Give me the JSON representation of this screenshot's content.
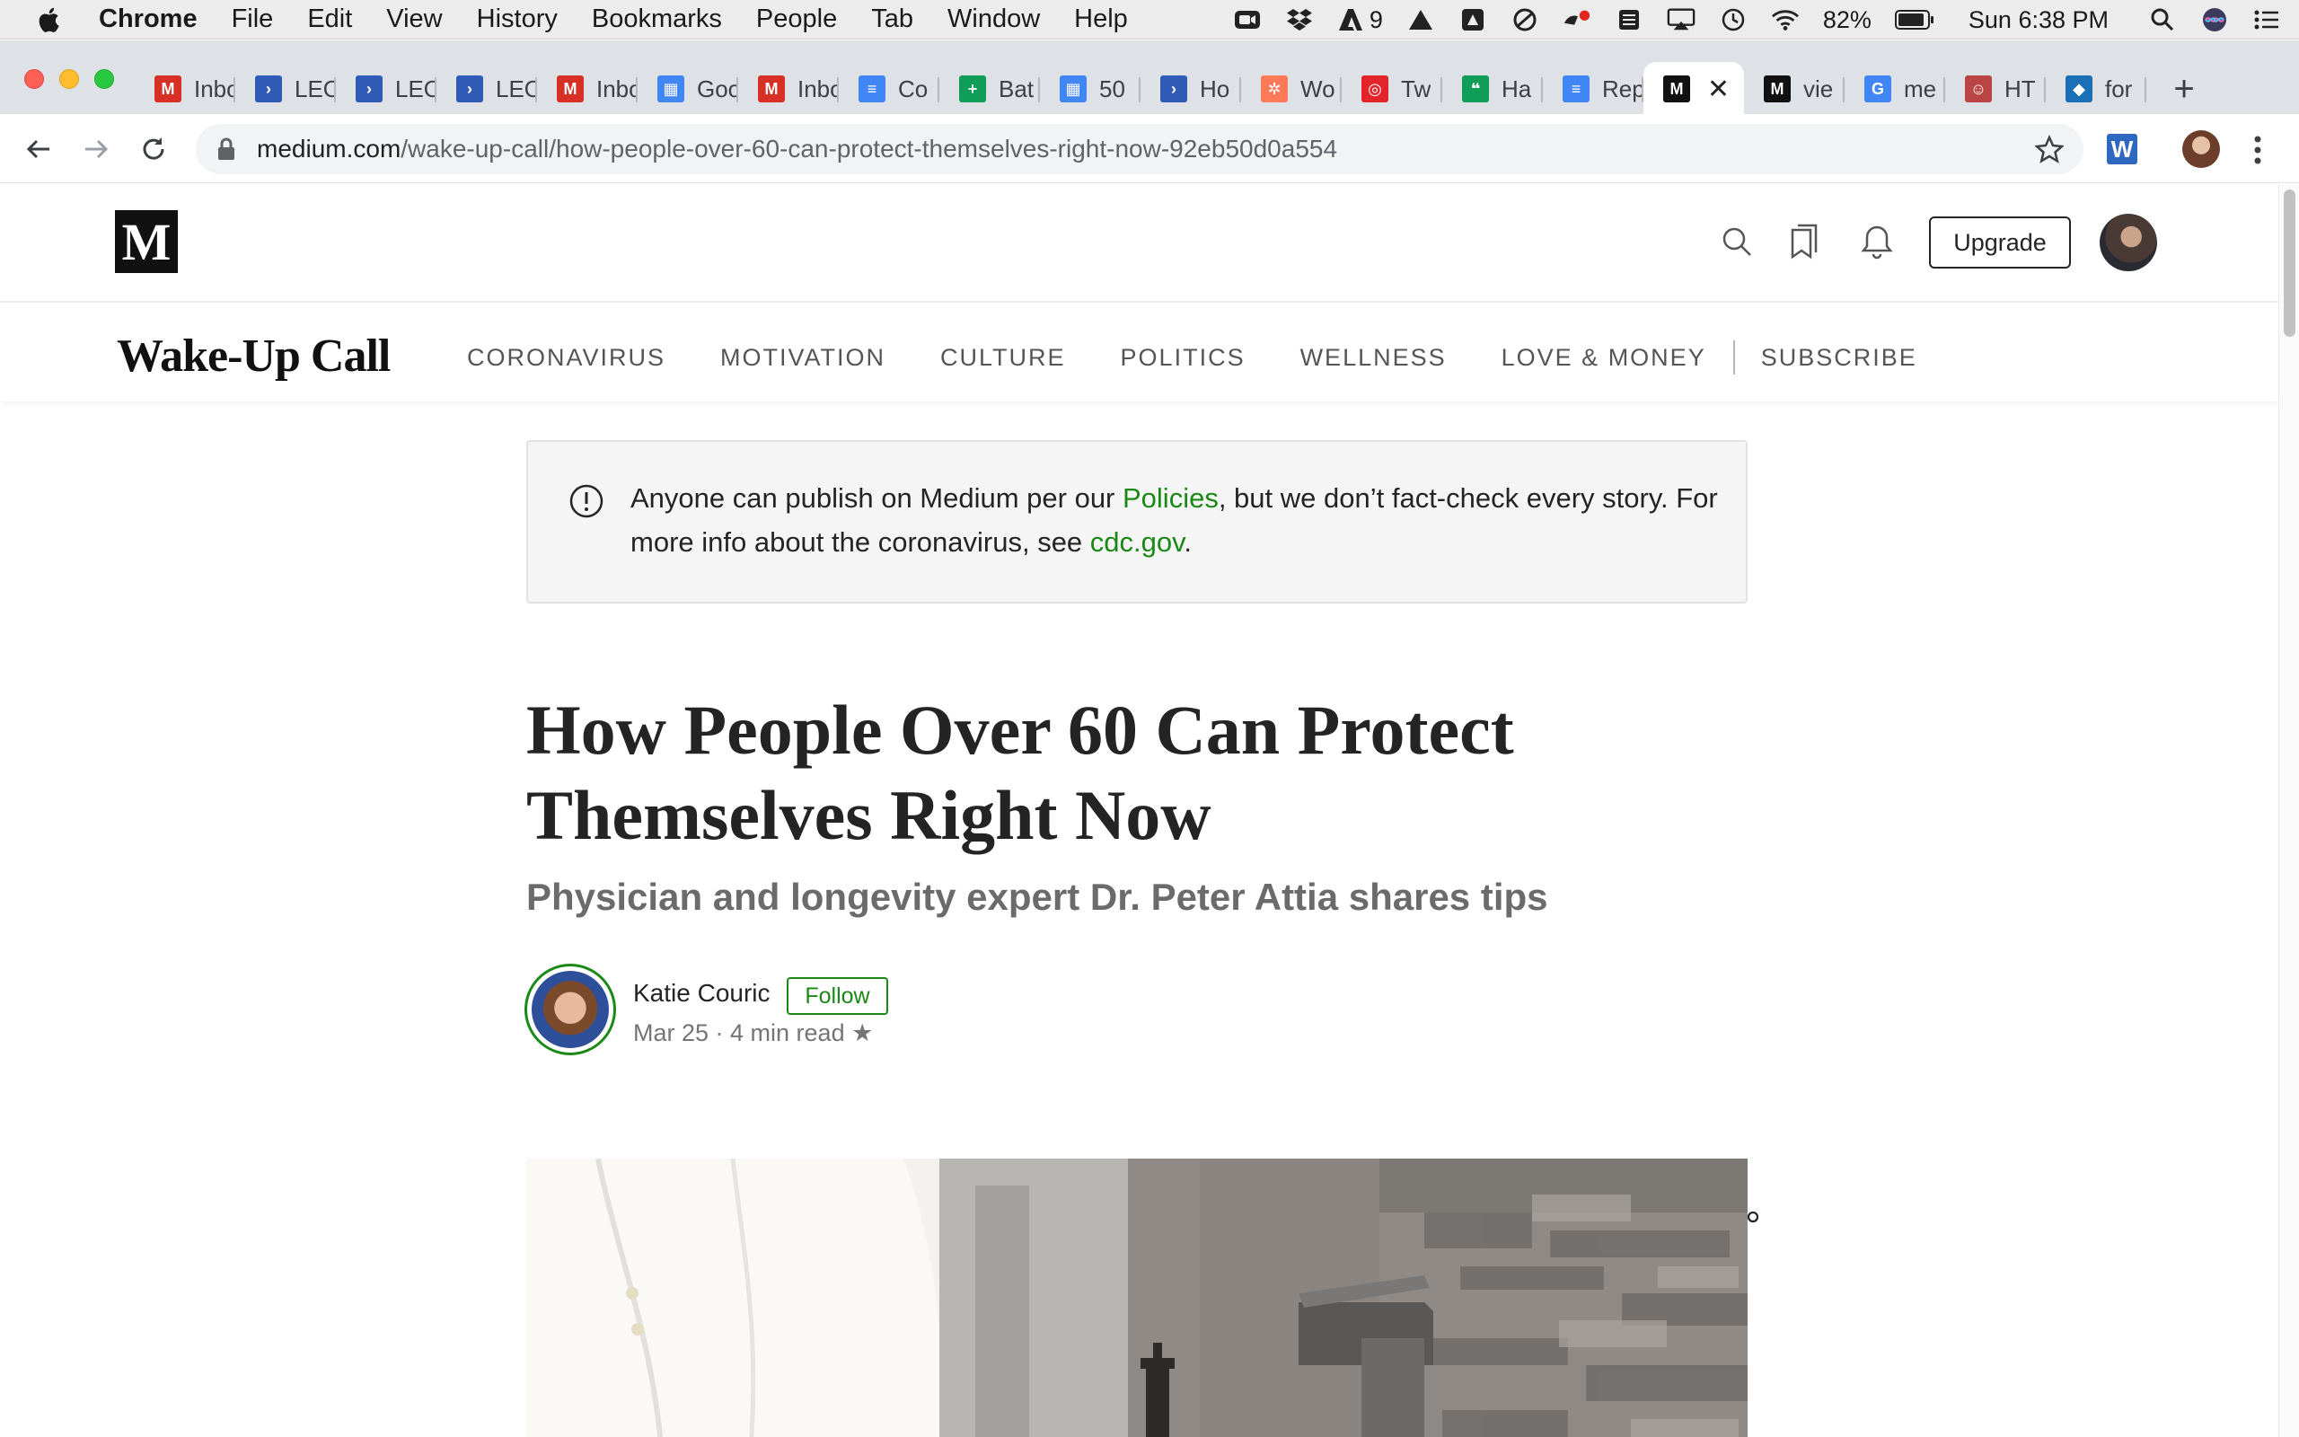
{
  "menubar": {
    "app": "Chrome",
    "items": [
      "File",
      "Edit",
      "View",
      "History",
      "Bookmarks",
      "People",
      "Tab",
      "Window",
      "Help"
    ],
    "notification_count": "9",
    "battery": "82%",
    "clock": "Sun 6:38 PM"
  },
  "tabs": [
    {
      "title": "Inbox",
      "icon": "gmail-icon",
      "color": "#d93025"
    },
    {
      "title": "LEO",
      "icon": "arrow-app-icon",
      "color": "#2f5bb7"
    },
    {
      "title": "LEO",
      "icon": "arrow-app-icon",
      "color": "#2f5bb7"
    },
    {
      "title": "LEO",
      "icon": "arrow-app-icon",
      "color": "#2f5bb7"
    },
    {
      "title": "Inbox",
      "icon": "gmail-icon",
      "color": "#d93025"
    },
    {
      "title": "Goo",
      "icon": "calendar-icon",
      "color": "#4285f4"
    },
    {
      "title": "Inbox",
      "icon": "gmail-icon",
      "color": "#d93025"
    },
    {
      "title": "Co",
      "icon": "docs-icon",
      "color": "#4285f4"
    },
    {
      "title": "Bat",
      "icon": "sheets-icon",
      "color": "#0f9d58"
    },
    {
      "title": "50",
      "icon": "calendar-icon",
      "color": "#4285f4"
    },
    {
      "title": "Ho",
      "icon": "arrow-app-icon",
      "color": "#2f5bb7"
    },
    {
      "title": "Wo",
      "icon": "hubspot-icon",
      "color": "#ff7a59"
    },
    {
      "title": "Tw",
      "icon": "circle-app-icon",
      "color": "#e3242b"
    },
    {
      "title": "Ha",
      "icon": "hangouts-icon",
      "color": "#0f9d58"
    },
    {
      "title": "Rep",
      "icon": "docs-icon",
      "color": "#4285f4"
    },
    {
      "title": "",
      "icon": "medium-icon",
      "color": "#111111",
      "active": true
    },
    {
      "title": "vie",
      "icon": "medium-icon",
      "color": "#111111"
    },
    {
      "title": "me",
      "icon": "google-icon",
      "color": "#4285f4"
    },
    {
      "title": "HT",
      "icon": "face-app-icon",
      "color": "#b44"
    },
    {
      "title": "for",
      "icon": "bird-app-icon",
      "color": "#1a6fb5"
    }
  ],
  "toolbar": {
    "url_host": "medium.com",
    "url_path": "/wake-up-call/how-people-over-60-can-protect-themselves-right-now-92eb50d0a554",
    "extension_label": "W"
  },
  "header": {
    "logo": "M",
    "upgrade_label": "Upgrade"
  },
  "publication": {
    "name": "Wake-Up Call",
    "nav": [
      "CORONAVIRUS",
      "MOTIVATION",
      "CULTURE",
      "POLITICS",
      "WELLNESS",
      "LOVE & MONEY"
    ],
    "subscribe": "SUBSCRIBE"
  },
  "notice": {
    "text_before": "Anyone can publish on Medium per our ",
    "policies_link": "Policies",
    "text_middle": ", but we don’t fact-check every story. For more info about the coronavirus, see ",
    "cdc_link": "cdc.gov",
    "text_end": "."
  },
  "article": {
    "title": "How People Over 60 Can Protect Themselves Right Now",
    "subtitle": "Physician and longevity expert Dr. Peter Attia shares tips",
    "author": "Katie Couric",
    "follow_label": "Follow",
    "meta": "Mar 25 · 4 min read ★"
  },
  "colors": {
    "accent_green": "#1a8917",
    "text_dark": "#242424",
    "text_muted": "#6b6b6b"
  }
}
